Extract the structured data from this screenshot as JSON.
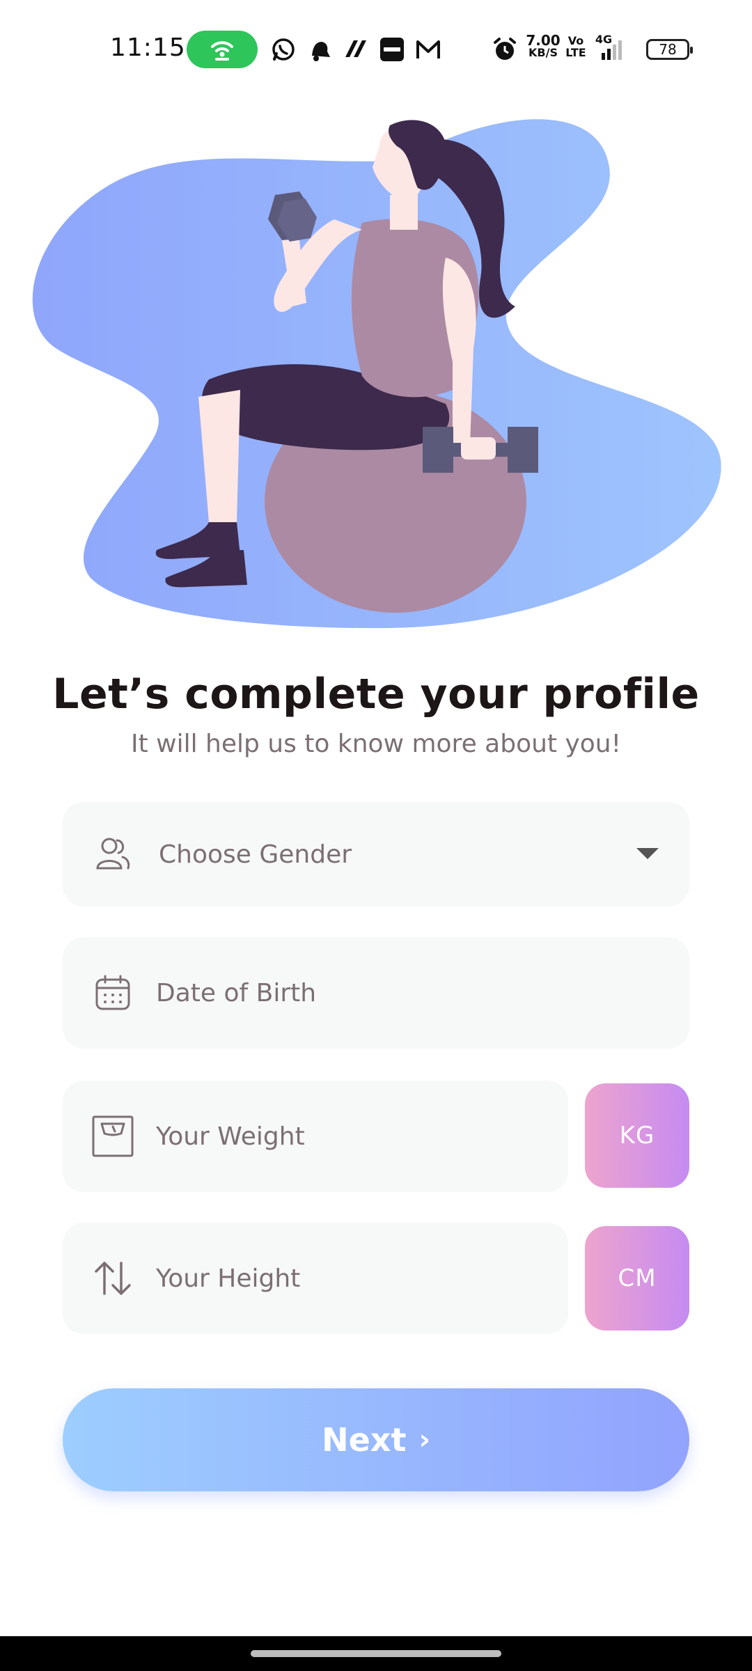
{
  "status_bar": {
    "time": "11:15",
    "net_speed_value": "7.00",
    "net_speed_unit": "KB/S",
    "volte_top": "Vo",
    "volte_bottom": "LTE",
    "network_type": "4G",
    "battery_level": "78",
    "icons": [
      "hotspot-icon",
      "whatsapp-icon",
      "notification-bell-icon",
      "app-icon",
      "paytm-icon",
      "gmail-icon",
      "alarm-icon",
      "signal-icon",
      "battery-icon"
    ]
  },
  "hero": {
    "illustration": "woman-exercising-on-ball-illustration"
  },
  "heading": {
    "title": "Let’s complete your profile",
    "subtitle": "It will help us to know more about you!"
  },
  "form": {
    "gender": {
      "placeholder": "Choose Gender",
      "icon": "two-users-icon"
    },
    "dob": {
      "placeholder": "Date of Birth",
      "icon": "calendar-icon"
    },
    "weight": {
      "placeholder": "Your Weight",
      "icon": "weight-scale-icon",
      "unit": "KG"
    },
    "height": {
      "placeholder": "Your Height",
      "icon": "swap-vertical-icon",
      "unit": "CM"
    }
  },
  "actions": {
    "next_label": "Next",
    "next_chevron": "›"
  },
  "colors": {
    "primary_gradient_start": "#9DCEFF",
    "primary_gradient_end": "#92A3FD",
    "unit_gradient_start": "#EEA4CE",
    "unit_gradient_end": "#C58BF2",
    "field_bg": "#F7F8F8",
    "text_dark": "#1D1617",
    "text_gray": "#7B6F72"
  }
}
